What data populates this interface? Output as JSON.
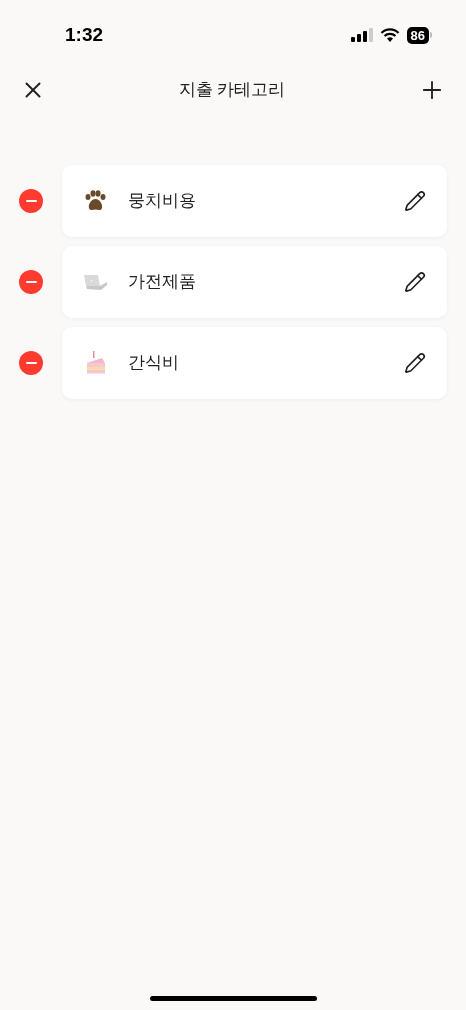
{
  "status_bar": {
    "time": "1:32",
    "battery": "86"
  },
  "header": {
    "title": "지출 카테고리"
  },
  "categories": [
    {
      "name": "뭉치비용",
      "kind": "paw"
    },
    {
      "name": "가전제품",
      "kind": "laptop"
    },
    {
      "name": "간식비",
      "kind": "cake"
    }
  ]
}
